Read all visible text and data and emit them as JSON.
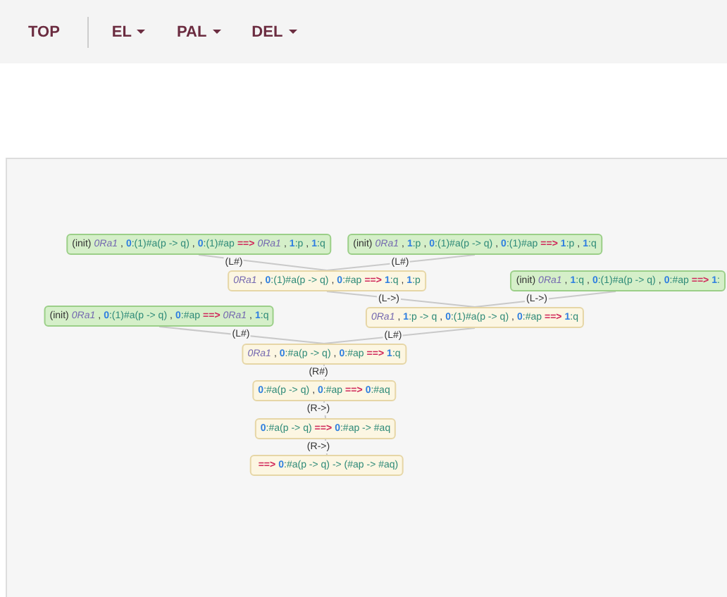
{
  "nav": [
    {
      "label": "TOP",
      "kind": "link"
    },
    {
      "label": "EL",
      "kind": "dropdown"
    },
    {
      "label": "PAL",
      "kind": "dropdown"
    },
    {
      "label": "DEL",
      "kind": "dropdown"
    }
  ],
  "proof_tree": {
    "kind": "sequent",
    "parts": [
      {
        "kind": "arrow",
        "text": "==>"
      },
      {
        "kind": "label",
        "text": "0"
      },
      {
        "kind": "formula",
        "text": ":#a(p -> q) -> (#ap -> #aq)"
      }
    ],
    "children": [
      {
        "rule": "(R->)",
        "kind": "sequent",
        "parts": [
          {
            "kind": "label",
            "text": "0"
          },
          {
            "kind": "formula",
            "text": ":#a(p -> q)"
          },
          {
            "kind": "arrow",
            "text": "==>"
          },
          {
            "kind": "label",
            "text": "0"
          },
          {
            "kind": "formula",
            "text": ":#ap -> #aq"
          }
        ],
        "children": [
          {
            "rule": "(R->)",
            "kind": "sequent",
            "parts": [
              {
                "kind": "label",
                "text": "0"
              },
              {
                "kind": "formula",
                "text": ":#a(p -> q)"
              },
              {
                "kind": "sep",
                "text": ","
              },
              {
                "kind": "label",
                "text": "0"
              },
              {
                "kind": "formula",
                "text": ":#ap"
              },
              {
                "kind": "arrow",
                "text": "==>"
              },
              {
                "kind": "label",
                "text": "0"
              },
              {
                "kind": "formula",
                "text": ":#aq"
              }
            ],
            "children": [
              {
                "rule": "(R#)",
                "kind": "sequent",
                "parts": [
                  {
                    "kind": "relation",
                    "text": "0Ra1"
                  },
                  {
                    "kind": "sep",
                    "text": ","
                  },
                  {
                    "kind": "label",
                    "text": "0"
                  },
                  {
                    "kind": "formula",
                    "text": ":#a(p -> q)"
                  },
                  {
                    "kind": "sep",
                    "text": ","
                  },
                  {
                    "kind": "label",
                    "text": "0"
                  },
                  {
                    "kind": "formula",
                    "text": ":#ap"
                  },
                  {
                    "kind": "arrow",
                    "text": "==>"
                  },
                  {
                    "kind": "label",
                    "text": "1"
                  },
                  {
                    "kind": "formula",
                    "text": ":q"
                  }
                ],
                "children": [
                  {
                    "rule": "(L#)",
                    "kind": "axiom",
                    "parts": [
                      {
                        "kind": "rule",
                        "text": "(init)"
                      },
                      {
                        "kind": "relation",
                        "text": "0Ra1"
                      },
                      {
                        "kind": "sep",
                        "text": ","
                      },
                      {
                        "kind": "label",
                        "text": "0"
                      },
                      {
                        "kind": "formula",
                        "text": ":(1)#a(p -> q)"
                      },
                      {
                        "kind": "sep",
                        "text": ","
                      },
                      {
                        "kind": "label",
                        "text": "0"
                      },
                      {
                        "kind": "formula",
                        "text": ":#ap"
                      },
                      {
                        "kind": "arrow",
                        "text": "==>"
                      },
                      {
                        "kind": "relation",
                        "text": "0Ra1"
                      },
                      {
                        "kind": "sep",
                        "text": ","
                      },
                      {
                        "kind": "label",
                        "text": "1"
                      },
                      {
                        "kind": "formula",
                        "text": ":q"
                      }
                    ]
                  },
                  {
                    "rule": "(L#)",
                    "kind": "sequent",
                    "parts": [
                      {
                        "kind": "relation",
                        "text": "0Ra1"
                      },
                      {
                        "kind": "sep",
                        "text": ","
                      },
                      {
                        "kind": "label",
                        "text": "1"
                      },
                      {
                        "kind": "formula",
                        "text": ":p -> q"
                      },
                      {
                        "kind": "sep",
                        "text": ","
                      },
                      {
                        "kind": "label",
                        "text": "0"
                      },
                      {
                        "kind": "formula",
                        "text": ":(1)#a(p -> q)"
                      },
                      {
                        "kind": "sep",
                        "text": ","
                      },
                      {
                        "kind": "label",
                        "text": "0"
                      },
                      {
                        "kind": "formula",
                        "text": ":#ap"
                      },
                      {
                        "kind": "arrow",
                        "text": "==>"
                      },
                      {
                        "kind": "label",
                        "text": "1"
                      },
                      {
                        "kind": "formula",
                        "text": ":q"
                      }
                    ],
                    "children": [
                      {
                        "rule": "(L->)",
                        "kind": "sequent",
                        "parts": [
                          {
                            "kind": "relation",
                            "text": "0Ra1"
                          },
                          {
                            "kind": "sep",
                            "text": ","
                          },
                          {
                            "kind": "label",
                            "text": "0"
                          },
                          {
                            "kind": "formula",
                            "text": ":(1)#a(p -> q)"
                          },
                          {
                            "kind": "sep",
                            "text": ","
                          },
                          {
                            "kind": "label",
                            "text": "0"
                          },
                          {
                            "kind": "formula",
                            "text": ":#ap"
                          },
                          {
                            "kind": "arrow",
                            "text": "==>"
                          },
                          {
                            "kind": "label",
                            "text": "1"
                          },
                          {
                            "kind": "formula",
                            "text": ":q"
                          },
                          {
                            "kind": "sep",
                            "text": ","
                          },
                          {
                            "kind": "label",
                            "text": "1"
                          },
                          {
                            "kind": "formula",
                            "text": ":p"
                          }
                        ],
                        "children": [
                          {
                            "rule": "(L#)",
                            "kind": "axiom",
                            "parts": [
                              {
                                "kind": "rule",
                                "text": "(init)"
                              },
                              {
                                "kind": "relation",
                                "text": "0Ra1"
                              },
                              {
                                "kind": "sep",
                                "text": ","
                              },
                              {
                                "kind": "label",
                                "text": "0"
                              },
                              {
                                "kind": "formula",
                                "text": ":(1)#a(p -> q)"
                              },
                              {
                                "kind": "sep",
                                "text": ","
                              },
                              {
                                "kind": "label",
                                "text": "0"
                              },
                              {
                                "kind": "formula",
                                "text": ":(1)#ap"
                              },
                              {
                                "kind": "arrow",
                                "text": "==>"
                              },
                              {
                                "kind": "relation",
                                "text": "0Ra1"
                              },
                              {
                                "kind": "sep",
                                "text": ","
                              },
                              {
                                "kind": "label",
                                "text": "1"
                              },
                              {
                                "kind": "formula",
                                "text": ":p"
                              },
                              {
                                "kind": "sep",
                                "text": ","
                              },
                              {
                                "kind": "label",
                                "text": "1"
                              },
                              {
                                "kind": "formula",
                                "text": ":q"
                              }
                            ]
                          },
                          {
                            "rule": "(L#)",
                            "kind": "axiom",
                            "parts": [
                              {
                                "kind": "rule",
                                "text": "(init)"
                              },
                              {
                                "kind": "relation",
                                "text": "0Ra1"
                              },
                              {
                                "kind": "sep",
                                "text": ","
                              },
                              {
                                "kind": "label",
                                "text": "1"
                              },
                              {
                                "kind": "formula",
                                "text": ":p"
                              },
                              {
                                "kind": "sep",
                                "text": ","
                              },
                              {
                                "kind": "label",
                                "text": "0"
                              },
                              {
                                "kind": "formula",
                                "text": ":(1)#a(p -> q)"
                              },
                              {
                                "kind": "sep",
                                "text": ","
                              },
                              {
                                "kind": "label",
                                "text": "0"
                              },
                              {
                                "kind": "formula",
                                "text": ":(1)#ap"
                              },
                              {
                                "kind": "arrow",
                                "text": "==>"
                              },
                              {
                                "kind": "label",
                                "text": "1"
                              },
                              {
                                "kind": "formula",
                                "text": ":p"
                              },
                              {
                                "kind": "sep",
                                "text": ","
                              },
                              {
                                "kind": "label",
                                "text": "1"
                              },
                              {
                                "kind": "formula",
                                "text": ":q"
                              }
                            ]
                          }
                        ]
                      },
                      {
                        "rule": "(L->)",
                        "kind": "axiom",
                        "parts": [
                          {
                            "kind": "rule",
                            "text": "(init)"
                          },
                          {
                            "kind": "relation",
                            "text": "0Ra1"
                          },
                          {
                            "kind": "sep",
                            "text": ","
                          },
                          {
                            "kind": "label",
                            "text": "1"
                          },
                          {
                            "kind": "formula",
                            "text": ":q"
                          },
                          {
                            "kind": "sep",
                            "text": ","
                          },
                          {
                            "kind": "label",
                            "text": "0"
                          },
                          {
                            "kind": "formula",
                            "text": ":(1)#a(p -> q)"
                          },
                          {
                            "kind": "sep",
                            "text": ","
                          },
                          {
                            "kind": "label",
                            "text": "0"
                          },
                          {
                            "kind": "formula",
                            "text": ":#ap"
                          },
                          {
                            "kind": "arrow",
                            "text": "==>"
                          },
                          {
                            "kind": "label",
                            "text": "1"
                          },
                          {
                            "kind": "formula",
                            "text": ":"
                          }
                        ]
                      }
                    ]
                  }
                ]
              }
            ]
          }
        ]
      }
    ]
  }
}
